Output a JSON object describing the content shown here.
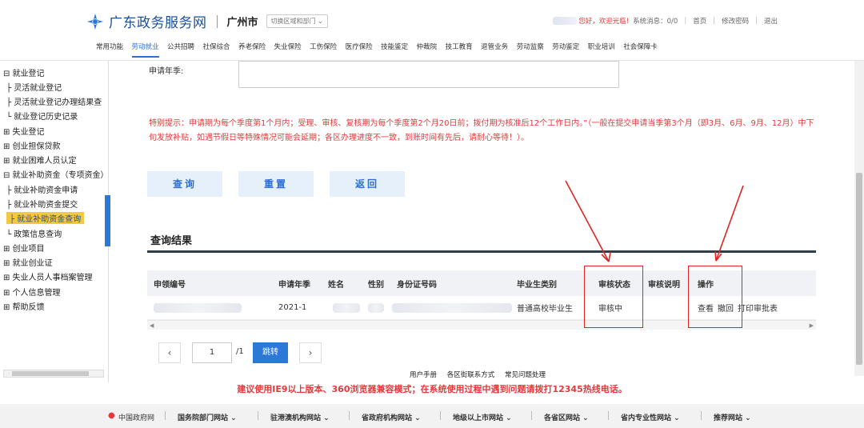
{
  "header": {
    "site_name": "广东政务服务网",
    "city": "广州市",
    "switch_label": "切换区域和部门 ⌄",
    "welcome": "您好，欢迎光临!",
    "messages": "系统消息：0/0",
    "home": "首页",
    "change_password": "修改密码",
    "logout": "退出"
  },
  "nav": [
    "常用功能",
    "劳动就业",
    "公共招聘",
    "社保综合",
    "养老保险",
    "失业保险",
    "工伤保险",
    "医疗保险",
    "技能鉴定",
    "仲裁院",
    "技工教育",
    "退管业务",
    "劳动监察",
    "劳动鉴定",
    "职业培训",
    "社会保障卡"
  ],
  "sidebar": {
    "items": [
      "⊟ 就业登记",
      "├ 灵活就业登记",
      "├ 灵活就业登记办理结果查",
      "└ 就业登记历史记录",
      "⊞ 失业登记",
      "⊞ 创业担保贷款",
      "⊞ 就业困难人员认定",
      "⊟ 就业补助资金（专项资金）",
      "├ 就业补助资金申请",
      "├ 就业补助资金提交",
      "├ 就业补助资金查询",
      "└ 政策信息查询",
      "⊞ 创业项目",
      "⊞ 就业创业证",
      "⊞ 失业人员人事档案管理",
      "⊞ 个人信息管理",
      "⊞ 帮助反馈"
    ]
  },
  "form": {
    "year_label": "申请年季:",
    "notice": "特别提示：申请期为每个季度第1个月内；受理、审核、复核期为每个季度第2个月20日前；拨付期为核准后12个工作日内。”（一般在提交申请当季第3个月（即3月、6月、9月、12月）中下旬发放补贴，如遇节假日等特殊情况可能会延期；各区办理进度不一致，到账时间有先后，请耐心等待！）。",
    "query_btn": "查询",
    "reset_btn": "重置",
    "back_btn": "返回"
  },
  "results": {
    "title": "查询结果",
    "columns": [
      "申领编号",
      "申请年季",
      "姓名",
      "性别",
      "身份证号码",
      "毕业生类别",
      "审核状态",
      "审核说明",
      "操作"
    ],
    "row": {
      "year": "2021-1",
      "category": "普通高校毕业生",
      "status": "审核中",
      "op_view": "查看",
      "op_cancel": "撤回",
      "op_print": "打印审批表"
    }
  },
  "pager": {
    "prev": "‹",
    "page": "1",
    "total": "/1",
    "jump": "跳转",
    "next": "›"
  },
  "footer_links": [
    "用户手册",
    "各区街联系方式",
    "常见问题处理"
  ],
  "warning": "建议使用IE9以上版本、360浏览器兼容模式；在系统使用过程中遇到问题请拨打12345热线电话。",
  "bottom_bar": [
    "中国政府网",
    "国务院部门网站 ⌄",
    "驻港澳机构网站 ⌄",
    "省政府机构网站 ⌄",
    "地级以上市网站 ⌄",
    "各省区网站 ⌄",
    "省内专业性网站 ⌄",
    "推荐网站 ⌄"
  ],
  "colors": {
    "brand": "#1a4f99",
    "accent": "#2b6fd6",
    "alert": "#e4393c",
    "annotation": "#e02424"
  }
}
